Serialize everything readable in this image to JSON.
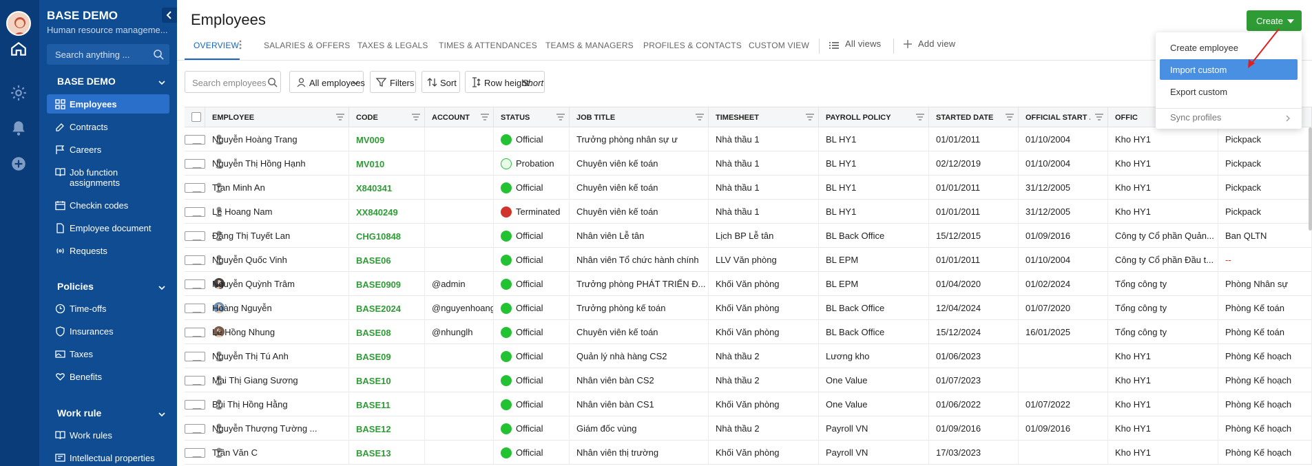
{
  "sidebar": {
    "brand_title": "BASE DEMO",
    "brand_subtitle": "Human resource manageme...",
    "search_placeholder": "Search anything ...",
    "group_base": "BASE DEMO",
    "items_main": [
      "Employees",
      "Contracts",
      "Careers",
      "Job function assignments",
      "Checkin codes",
      "Employee document",
      "Requests"
    ],
    "group_policies": "Policies",
    "items_policies": [
      "Time-offs",
      "Insurances",
      "Taxes",
      "Benefits"
    ],
    "group_work": "Work rule",
    "items_work": [
      "Work rules",
      "Intellectual properties"
    ]
  },
  "header": {
    "title": "Employees",
    "create_label": "Create"
  },
  "tabs": [
    "OVERVIEW",
    "SALARIES & OFFERS",
    "TAXES & LEGALS",
    "TIMES & ATTENDANCES",
    "TEAMS & MANAGERS",
    "PROFILES & CONTACTS",
    "CUSTOM VIEW"
  ],
  "tab_all_views": "All views",
  "tab_add_view": "Add view",
  "toolbar": {
    "search_placeholder": "Search employees",
    "all_employees": "All employees",
    "filters": "Filters",
    "sort": "Sort",
    "row_height_label": "Row height:",
    "row_height_value": "Short"
  },
  "columns": [
    "EMPLOYEE",
    "CODE",
    "ACCOUNT",
    "STATUS",
    "JOB TITLE",
    "TIMESHEET",
    "PAYROLL POLICY",
    "STARTED DATE",
    "OFFICIAL START ...",
    "OFFIC"
  ],
  "rows": [
    {
      "employee": "Nguyễn Hoàng Trang",
      "code": "MV009",
      "account": "",
      "status": "Official",
      "job": "Trưởng phòng nhân sự ư",
      "timesheet": "Nhà thầu 1",
      "payroll": "BL HY1",
      "started": "01/01/2011",
      "official": "01/10/2004",
      "office": "Kho HY1",
      "dept": "Pickpack"
    },
    {
      "employee": "Nguyễn Thị Hồng Hạnh",
      "code": "MV010",
      "account": "",
      "status": "Probation",
      "job": "Chuyên viên kế toán",
      "timesheet": "Nhà thầu 1",
      "payroll": "BL HY1",
      "started": "02/12/2019",
      "official": "01/10/2004",
      "office": "Kho HY1",
      "dept": "Pickpack"
    },
    {
      "employee": "Tran Minh An",
      "code": "X840341",
      "account": "",
      "status": "Official",
      "job": "Chuyên viên kế toán",
      "timesheet": "Nhà thầu 1",
      "payroll": "BL HY1",
      "started": "01/01/2011",
      "official": "31/12/2005",
      "office": "Kho HY1",
      "dept": "Pickpack"
    },
    {
      "employee": "Le Hoang Nam",
      "code": "XX840249",
      "account": "",
      "status": "Terminated",
      "job": "Chuyên viên kế toán",
      "timesheet": "Nhà thầu 1",
      "payroll": "BL HY1",
      "started": "01/01/2011",
      "official": "31/12/2005",
      "office": "Kho HY1",
      "dept": "Pickpack"
    },
    {
      "employee": "Đặng Thị Tuyết Lan",
      "code": "CHG10848",
      "account": "",
      "status": "Official",
      "job": "Nhân viên Lễ tân",
      "timesheet": "Lịch BP Lễ tân",
      "payroll": "BL Back Office",
      "started": "15/12/2015",
      "official": "01/09/2016",
      "office": "Công ty Cổ phần Quản...",
      "dept": "Ban QLTN"
    },
    {
      "employee": "Nguyễn Quốc Vinh",
      "code": "BASE06",
      "account": "",
      "status": "Official",
      "job": "Nhân viên Tổ chức hành chính",
      "timesheet": "LLV Văn phòng",
      "payroll": "BL EPM",
      "started": "01/01/2011",
      "official": "01/10/2004",
      "office": "Công ty Cổ phần Đầu t...",
      "dept": "--"
    },
    {
      "employee": "Nguyễn Quỳnh Trâm",
      "code": "BASE0909",
      "account": "@admin",
      "status": "Official",
      "job": "Trưởng phòng PHÁT TRIỂN Đ...",
      "timesheet": "Khối Văn phòng",
      "payroll": "BL EPM",
      "started": "01/04/2020",
      "official": "01/02/2024",
      "office": "Tổng công ty",
      "dept": "Phòng Nhân sự"
    },
    {
      "employee": "Hoàng Nguyễn",
      "code": "BASE2024",
      "account": "@nguyenhoang",
      "status": "Official",
      "job": "Trưởng phòng kế toán",
      "timesheet": "Khối Văn phòng",
      "payroll": "BL Back Office",
      "started": "12/04/2024",
      "official": "01/07/2020",
      "office": "Tổng công ty",
      "dept": "Phòng Kế toán"
    },
    {
      "employee": "Lê Hồng Nhung",
      "code": "BASE08",
      "account": "@nhunglh",
      "status": "Official",
      "job": "Chuyên viên kế toán",
      "timesheet": "Khối Văn phòng",
      "payroll": "BL Back Office",
      "started": "15/12/2024",
      "official": "16/01/2025",
      "office": "Tổng công ty",
      "dept": "Phòng Kế toán"
    },
    {
      "employee": "Nguyễn Thị Tú Anh",
      "code": "BASE09",
      "account": "",
      "status": "Official",
      "job": "Quản lý nhà hàng CS2",
      "timesheet": "Nhà thầu 2",
      "payroll": "Lương kho",
      "started": "01/06/2023",
      "official": "",
      "office": "Kho HY1",
      "dept": "Phòng Kế hoạch"
    },
    {
      "employee": "Mai Thị Giang Sương",
      "code": "BASE10",
      "account": "",
      "status": "Official",
      "job": "Nhân viên bàn CS2",
      "timesheet": "Nhà thầu 2",
      "payroll": "One Value",
      "started": "01/07/2023",
      "official": "",
      "office": "Kho HY1",
      "dept": "Phòng Kế hoạch"
    },
    {
      "employee": "Bùi Thị Hồng Hằng",
      "code": "BASE11",
      "account": "",
      "status": "Official",
      "job": "Nhân viên bàn CS1",
      "timesheet": "Khối Văn phòng",
      "payroll": "One Value",
      "started": "01/06/2022",
      "official": "01/07/2022",
      "office": "Kho HY1",
      "dept": "Phòng Kế hoạch"
    },
    {
      "employee": "Nguyễn Thượng Tường ...",
      "code": "BASE12",
      "account": "",
      "status": "Official",
      "job": "Giám đốc vùng",
      "timesheet": "Nhà thầu 2",
      "payroll": "Payroll VN",
      "started": "01/09/2016",
      "official": "01/09/2016",
      "office": "Kho HY1",
      "dept": "Phòng Kế hoạch"
    },
    {
      "employee": "Trần Văn C",
      "code": "BASE13",
      "account": "",
      "status": "Official",
      "job": "Nhân viên thị trường",
      "timesheet": "Khối Văn phòng",
      "payroll": "Payroll VN",
      "started": "17/03/2023",
      "official": "",
      "office": "Kho HY1",
      "dept": "Phòng Kế hoạch"
    }
  ],
  "create_menu": {
    "items": [
      "Create employee",
      "Import custom",
      "Export custom"
    ],
    "sync": "Sync profiles"
  },
  "colors": {
    "sidebar": "#0f4c92",
    "rail": "#0b3c7a",
    "accent": "#1565c0",
    "create": "#2e9b35",
    "official": "#22c232",
    "terminated": "#d0342c"
  }
}
